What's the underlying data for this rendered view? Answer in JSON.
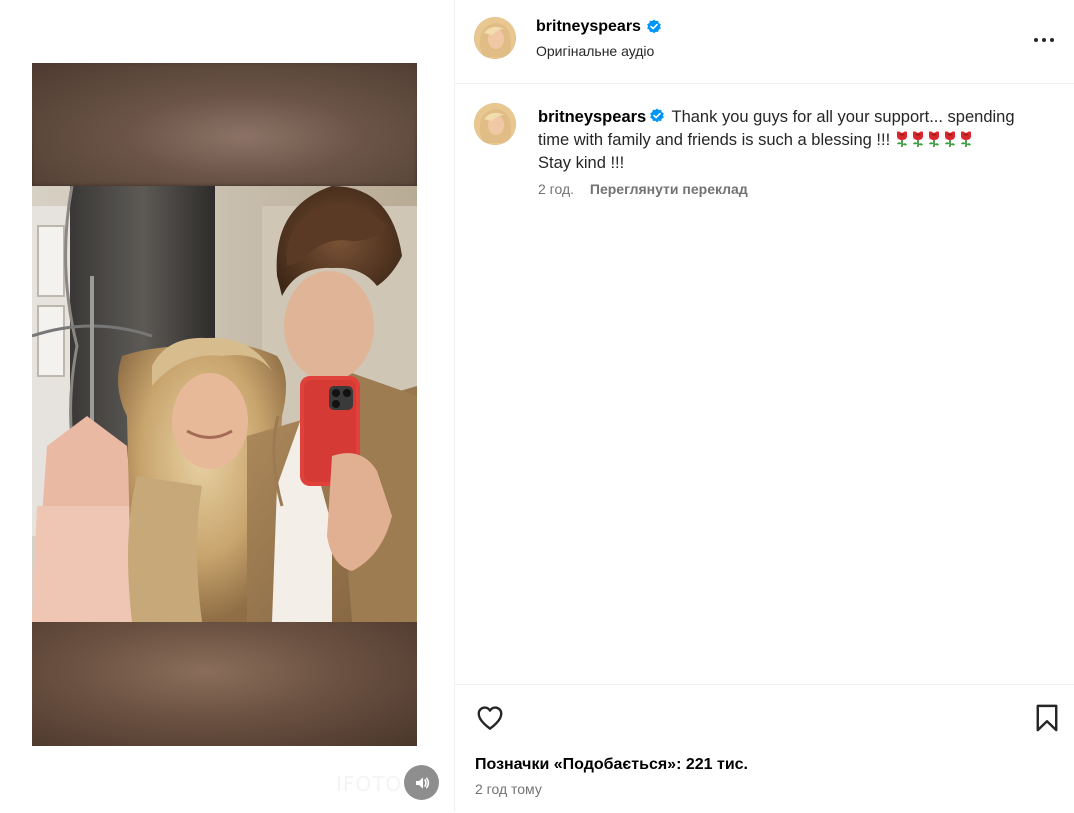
{
  "post": {
    "username": "britneyspears",
    "audio_label": "Оригінальне аудіо",
    "caption_text": "Thank you guys for all your support... spending time with family and friends is such a blessing !!!",
    "caption_line2": "Stay kind !!!",
    "emoji": "rose-emoji",
    "emoji_count": 5,
    "comment_time": "2 год.",
    "translate_label": "Переглянути переклад",
    "likes_label": "Позначки «Подобається»: 221 тис.",
    "posted_ago": "2 год тому"
  },
  "video": {
    "watermark": "IFOTO"
  },
  "icons": {
    "verified": "verified-badge-icon",
    "more": "more-options-icon",
    "like": "heart-icon",
    "save": "bookmark-icon",
    "sound": "speaker-icon"
  },
  "colors": {
    "verified_blue": "#0095f6",
    "text_primary": "#262626",
    "text_secondary": "#737373",
    "divider": "#efefef"
  }
}
